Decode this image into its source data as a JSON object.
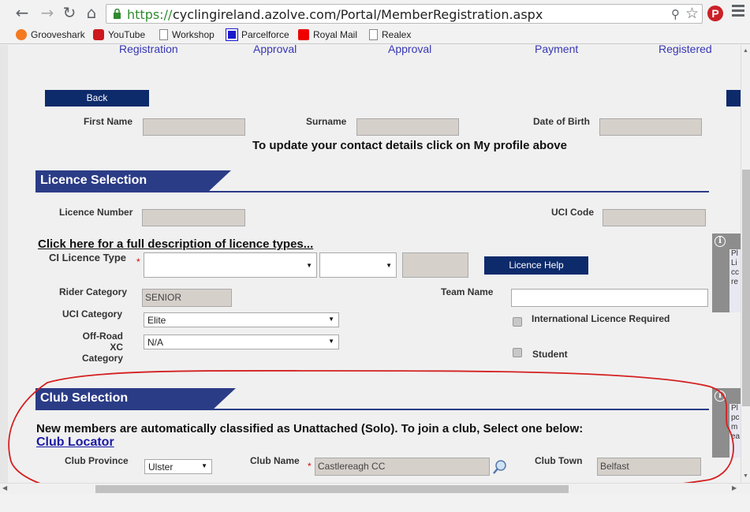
{
  "browser": {
    "url_scheme": "https://",
    "url_rest": "cyclingireland.azolve.com/Portal/MemberRegistration.aspx",
    "bookmarks": [
      "Grooveshark",
      "YouTube",
      "Workshop",
      "Parcelforce",
      "Royal Mail",
      "Realex"
    ]
  },
  "steps": [
    "Registration",
    "Approval",
    "Approval",
    "Payment",
    "Registered"
  ],
  "back_label": "Back",
  "personal": {
    "first_name_label": "First Name",
    "surname_label": "Surname",
    "dob_label": "Date of Birth",
    "profile_notice": "To update your contact details click on My profile above"
  },
  "licence": {
    "section_title": "Licence Selection",
    "licence_number_label": "Licence Number",
    "uci_code_label": "UCI Code",
    "description_link": "Click here for a full description of licence types...",
    "ci_licence_type_label": "CI Licence Type",
    "required_marker": "*",
    "help_button": "Licence Help",
    "rider_category_label": "Rider Category",
    "rider_category_value": "SENIOR",
    "team_name_label": "Team Name",
    "uci_category_label": "UCI Category",
    "uci_category_value": "Elite",
    "offroad_label_1": "Off-Road XC",
    "offroad_label_2": "Category",
    "offroad_value": "N/A",
    "intl_licence_label": "International Licence Required",
    "student_label": "Student",
    "side_text": "Pl Li cc re"
  },
  "club": {
    "section_title": "Club Selection",
    "notice": "New members are automatically classified as Unattached (Solo). To join a club, Select one below:",
    "locator_link": "Club Locator",
    "province_label": "Club Province",
    "province_value": "Ulster",
    "name_label": "Club Name",
    "name_value": "Castlereagh CC",
    "town_label": "Club Town",
    "town_value": "Belfast",
    "side_text": "Pl pc m ea"
  },
  "colors": {
    "section_blue": "#2b3c86",
    "button_navy": "#0d2a6b",
    "annotation_red": "#d42020"
  }
}
